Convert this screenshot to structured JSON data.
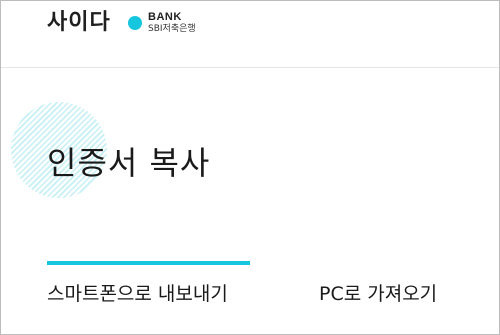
{
  "header": {
    "logo_korean": "사이다",
    "logo_bank": "BANK",
    "logo_sbi": "SBI저축은행",
    "accent_color": "#16c6df"
  },
  "main": {
    "title": "인증서 복사",
    "tabs": [
      {
        "label": "스마트폰으로 내보내기",
        "active": true
      },
      {
        "label": "PC로 가져오기",
        "active": false
      }
    ]
  }
}
